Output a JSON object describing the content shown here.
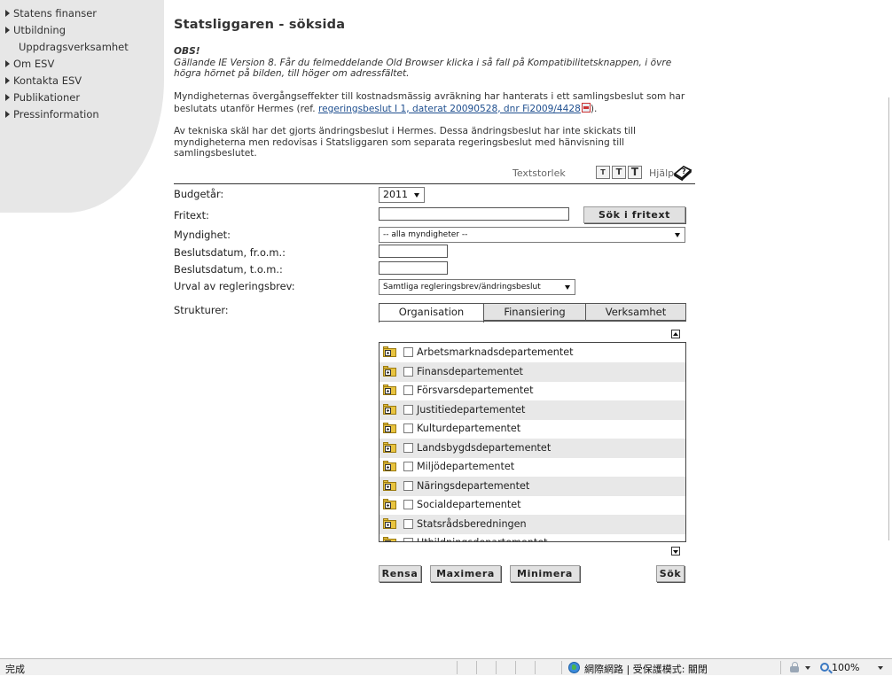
{
  "sidebar": {
    "items": [
      {
        "label": "Statens finanser"
      },
      {
        "label": "Utbildning"
      },
      {
        "label": "Uppdragsverksamhet"
      },
      {
        "label": "Om ESV"
      },
      {
        "label": "Kontakta ESV"
      },
      {
        "label": "Publikationer"
      },
      {
        "label": "Pressinformation"
      }
    ]
  },
  "page": {
    "title": "Statsliggaren - söksida",
    "obs_heading": "OBS!",
    "obs_text": "Gällande IE Version 8. Får du felmeddelande Old Browser klicka i så fall på Kompatibilitetsknappen, i övre högra hörnet på bilden, till höger om adressfältet.",
    "effects_text_before": "Myndigheternas övergångseffekter till kostnadsmässig avräkning har hanterats i ett samlingsbeslut som har beslutats utanför Hermes (ref. ",
    "effects_link": "regeringsbeslut I 1, daterat 20090528, dnr Fi2009/4428",
    "effects_text_after": ").",
    "technical_text": "Av tekniska skäl har det gjorts ändringsbeslut i Hermes. Dessa ändringsbeslut har inte skickats till myndigheterna men redovisas i Statsliggaren som separata regeringsbeslut med hänvisning till samlingsbeslutet."
  },
  "textsize": {
    "label": "Textstorlek",
    "small": "T",
    "medium": "T",
    "large": "T",
    "help_label": "Hjälp"
  },
  "form": {
    "budget_label": "Budgetår:",
    "budget_value": "2011",
    "fritext_label": "Fritext:",
    "fritext_value": "",
    "fritext_button": "Sök i fritext",
    "myndighet_label": "Myndighet:",
    "myndighet_value": "-- alla myndigheter --",
    "from_label": "Beslutsdatum, fr.o.m.:",
    "from_value": "",
    "tom_label": "Beslutsdatum, t.o.m.:",
    "tom_value": "",
    "urval_label": "Urval av regleringsbrev:",
    "urval_value": "Samtliga regleringsbrev/ändringsbeslut",
    "strukturer_label": "Strukturer:"
  },
  "tabs": [
    {
      "label": "Organisation",
      "active": true
    },
    {
      "label": "Finansiering",
      "active": false
    },
    {
      "label": "Verksamhet",
      "active": false
    }
  ],
  "tree": {
    "items": [
      {
        "label": "Arbetsmarknadsdepartementet"
      },
      {
        "label": "Finansdepartementet"
      },
      {
        "label": "Försvarsdepartementet"
      },
      {
        "label": "Justitiedepartementet"
      },
      {
        "label": "Kulturdepartementet"
      },
      {
        "label": "Landsbygdsdepartementet"
      },
      {
        "label": "Miljödepartementet"
      },
      {
        "label": "Näringsdepartementet"
      },
      {
        "label": "Socialdepartementet"
      },
      {
        "label": "Statsrådsberedningen"
      },
      {
        "label": "Utbildningsdepartementet"
      }
    ]
  },
  "buttons": {
    "rensa": "Rensa",
    "maximera": "Maximera",
    "minimera": "Minimera",
    "sok": "Sök"
  },
  "statusbar": {
    "status": "完成",
    "zone": "網際網路 | 受保護模式: 關閉",
    "zoom": "100%"
  },
  "icons": {
    "folder": "folder-plus-icon",
    "help": "help-book-icon",
    "pdf": "pdf-icon",
    "globe": "globe-icon",
    "zoom": "zoom-icon"
  }
}
